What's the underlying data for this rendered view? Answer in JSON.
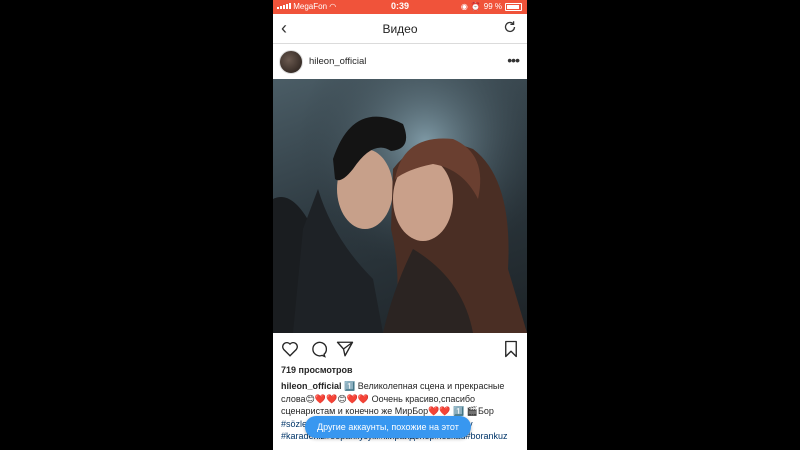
{
  "status_bar": {
    "carrier": "MegaFon",
    "time": "0:39",
    "battery": "99 %"
  },
  "nav": {
    "title": "Видео"
  },
  "post": {
    "username": "hileon_official",
    "views": "719 просмотров",
    "caption": {
      "username": "hileon_official",
      "text": "1️⃣ Великолепная сцена и прекрасные слова😊❤️❤️😊❤️❤️ Оочень красиво,спасибо сценаристам и конечно же МирБор❤️❤️ 1️⃣ 🎬Бор",
      "hashtags": "#sözleşme #cagatayulusoy #hazalkaya #ceycey #karadeniz#боранкузум#мирайдэнер#leskad#borankuz"
    }
  },
  "suggest_button": {
    "label": "Другие аккаунты, похожие на этот"
  },
  "colors": {
    "status_bar": "#f0533a",
    "accent": "#3897f0"
  }
}
